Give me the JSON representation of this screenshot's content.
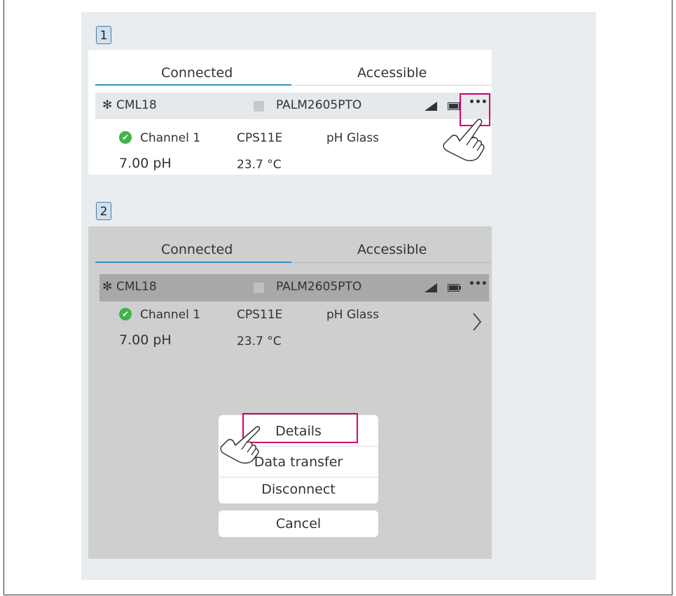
{
  "steps": [
    "1",
    "2"
  ],
  "screen1": {
    "tabs": {
      "connected": "Connected",
      "accessible": "Accessible"
    },
    "device": {
      "name": "CML18",
      "id": "PALM2605PTO",
      "more": "•••"
    },
    "channel": {
      "name": "Channel 1",
      "sensor": "CPS11E",
      "type": "pH Glass",
      "value": "7.00 pH",
      "temperature": "23.7 °C"
    }
  },
  "screen2": {
    "tabs": {
      "connected": "Connected",
      "accessible": "Accessible"
    },
    "device": {
      "name": "CML18",
      "id": "PALM2605PTO",
      "more": "•••"
    },
    "channel": {
      "name": "Channel 1",
      "sensor": "CPS11E",
      "type": "pH Glass",
      "value": "7.00 pH",
      "temperature": "23.7 °C"
    },
    "menu": {
      "details": "Details",
      "data_transfer": "Data transfer",
      "disconnect": "Disconnect",
      "cancel": "Cancel"
    }
  },
  "icons": [
    "bluetooth-icon",
    "signal-icon",
    "battery-icon",
    "more-icon",
    "check-icon",
    "chevron-right-icon",
    "hand-pointer-icon"
  ],
  "colors": {
    "accent": "#3a8dc2",
    "highlight": "#d6006e",
    "ok": "#3cb54a",
    "panel": "#e8edf0",
    "overlay": "#cfcfcf"
  }
}
